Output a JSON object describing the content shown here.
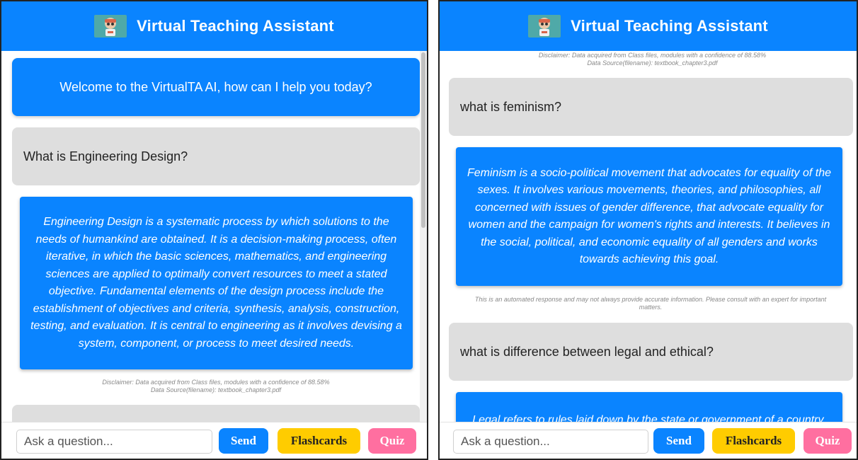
{
  "app": {
    "title": "Virtual Teaching Assistant",
    "logo_icon": "robot-icon",
    "colors": {
      "primary": "#0a84ff",
      "user_bubble": "#dedede",
      "flashcards": "#ffcc00",
      "quiz": "#ff6fa0"
    }
  },
  "left": {
    "welcome": "Welcome to the VirtualTA AI, how can I help you today?",
    "question1": "What is Engineering Design?",
    "answer1_lines": [
      "Engineering Design is a systematic process by which solutions to the",
      "needs of humankind are obtained. It is a decision-making process, often",
      "iterative, in which the basic sciences, mathematics, and engineering",
      "sciences are applied to optimally convert resources to meet a stated",
      "objective. Fundamental elements of the design process include the",
      "establishment of objectives and criteria, synthesis, analysis, construction,",
      "testing, and evaluation. It is central to engineering as it involves devising a",
      "system, component, or process to meet desired needs."
    ],
    "disclaimer_line1": "Disclaimer: Data acquired from Class files, modules with a confidence of 88.58%",
    "disclaimer_line2": "Data Source(filename): textbook_chapter3.pdf"
  },
  "right": {
    "disclaimer_line1": "Disclaimer: Data acquired from Class files, modules with a confidence of 88.58%",
    "disclaimer_line2": "Data Source(filename): textbook_chapter3.pdf",
    "question1": "what is feminism?",
    "answer1_lines": [
      "Feminism is a socio-political movement that advocates for equality of the",
      "sexes. It involves various movements, theories, and philosophies, all",
      "concerned with issues of gender difference, that advocate equality for",
      "women and the campaign for women's rights and interests. It believes in",
      "the social, political, and economic equality of all genders and works",
      "towards achieving this goal."
    ],
    "automated_line1": "This is an automated response and may not always provide accurate information. Please consult with an expert for important",
    "automated_line2": "matters.",
    "question2": "what is difference between legal and ethical?",
    "answer2_partial": "Legal refers to rules laid down by the state or government of a country,"
  },
  "input_bar": {
    "placeholder": "Ask a question...",
    "send_label": "Send",
    "flashcards_label": "Flashcards",
    "quiz_label": "Quiz"
  }
}
